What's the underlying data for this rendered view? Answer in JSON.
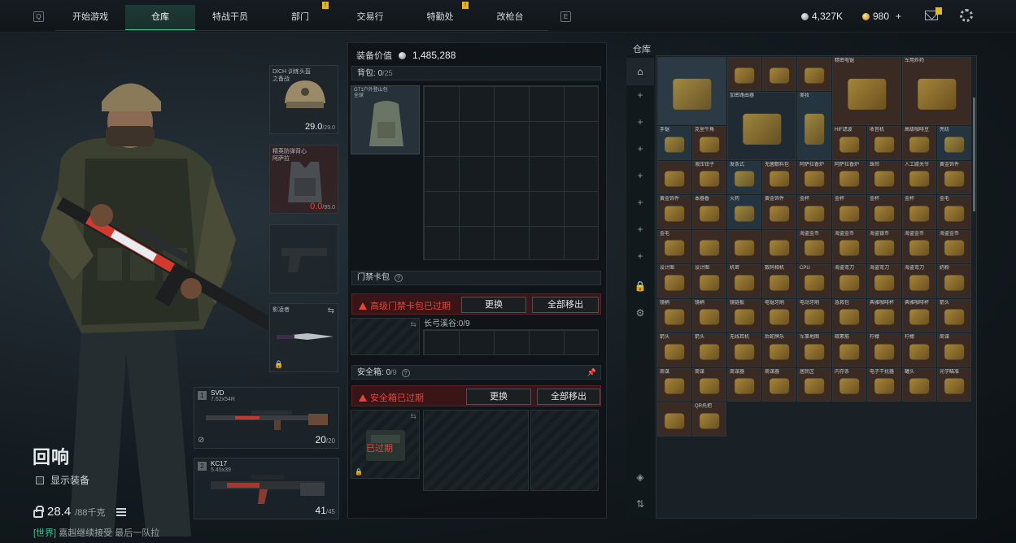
{
  "topbar": {
    "left_key": "Q",
    "right_key": "E",
    "tabs": [
      {
        "label": "开始游戏",
        "active": false,
        "badge": false
      },
      {
        "label": "仓库",
        "active": true,
        "badge": false
      },
      {
        "label": "特战干员",
        "active": false,
        "badge": false
      },
      {
        "label": "部门",
        "active": false,
        "badge": true
      },
      {
        "label": "交易行",
        "active": false,
        "badge": false
      },
      {
        "label": "特勤处",
        "active": false,
        "badge": true
      },
      {
        "label": "改枪台",
        "active": false,
        "badge": false
      }
    ],
    "silver": "4,327K",
    "gold": "980",
    "gold_plus": "+"
  },
  "operator": {
    "name": "回响",
    "show_equipment_label": "显示装备",
    "weight_value": "28.4",
    "weight_max": "/88千克",
    "chat_channel": "[世界]",
    "chat_text": "嘉赳继续接受  最后一队拉"
  },
  "gear": {
    "helmet_name": "DICH 训练头盔",
    "helmet_sub": "之备战",
    "helmet_dur": "29.0",
    "helmet_max": "/29.0",
    "armor_name": "精英防弹背心",
    "armor_sub": "阿萨拉",
    "armor_dur": "0.0",
    "armor_max": "/95.0",
    "melee_name": "影凌者"
  },
  "weapons": [
    {
      "num": "1",
      "name": "SVD",
      "caliber": "7.62x54R",
      "ammo": "20",
      "ammo_max": "/20"
    },
    {
      "num": "2",
      "name": "KC17",
      "caliber": "5.45x39",
      "ammo": "41",
      "ammo_max": "/45"
    }
  ],
  "loadout": {
    "value_label": "装备价值",
    "value": "1,485,288",
    "backpack_label": "背包:",
    "backpack_count": "0",
    "backpack_cap": "/25",
    "backpack_item": "GT1户外登山包",
    "backpack_item_sub": "全球",
    "keycard_label": "门禁卡包",
    "keycard_warning": "高级门禁卡包已过期",
    "replace_btn": "更换",
    "move_all_btn": "全部移出",
    "keycard_slot": "长弓溪谷:",
    "keycard_count": "0/9",
    "keycard_expired": "已过期",
    "safebox_label": "安全箱:",
    "safebox_count": "0",
    "safebox_cap": "/9",
    "safebox_warning": "安全箱已过期",
    "safebox_expired": "已过期"
  },
  "stash": {
    "title": "仓库",
    "cells": [
      {
        "label": "",
        "color": "#2b3a44"
      },
      {
        "label": "",
        "color": "#3a2a24"
      },
      {
        "label": "",
        "color": "#3a2a24"
      },
      {
        "label": "",
        "color": "#3a2a24"
      },
      {
        "label": "精密电锯",
        "color": "#3a2a24"
      },
      {
        "label": "军用炸药",
        "color": "#3a2a24"
      },
      {
        "label": "加密路由器",
        "color": "#1f2a33"
      },
      {
        "label": "美妆",
        "color": "#243540"
      },
      {
        "label": "手锯",
        "color": "#243540"
      },
      {
        "label": "克里牛角",
        "color": "#3a2a24"
      },
      {
        "label": "HIF滤波",
        "color": "#3a2a24"
      },
      {
        "label": "收音机",
        "color": "#3a2a24"
      },
      {
        "label": "高级咖啡豆",
        "color": "#3a2a24"
      },
      {
        "label": "亮纺",
        "color": "#243540"
      },
      {
        "label": "",
        "color": "#3a2a24"
      },
      {
        "label": "液压钳子",
        "color": "#3a2a24"
      },
      {
        "label": "发条式",
        "color": "#243540"
      },
      {
        "label": "无菌敷料包",
        "color": "#3a2a24"
      },
      {
        "label": "阿萨拉香炉",
        "color": "#3a2a24"
      },
      {
        "label": "阿萨拉香炉",
        "color": "#3a2a24"
      },
      {
        "label": "珠帘",
        "color": "#3a2a24"
      },
      {
        "label": "人工膝关节",
        "color": "#3a2a24"
      },
      {
        "label": "黄金饰件",
        "color": "#3a2a24"
      },
      {
        "label": "黄金饰件",
        "color": "#3a2a24"
      },
      {
        "label": "本器香",
        "color": "#3a2a24"
      },
      {
        "label": "火药",
        "color": "#243540"
      },
      {
        "label": "黄金饰件",
        "color": "#3a2a24"
      },
      {
        "label": "金杯",
        "color": "#3a2a24"
      },
      {
        "label": "金杯",
        "color": "#3a2a24"
      },
      {
        "label": "金杯",
        "color": "#3a2a24"
      },
      {
        "label": "金杯",
        "color": "#3a2a24"
      },
      {
        "label": "金毛",
        "color": "#3a2a24"
      },
      {
        "label": "金毛",
        "color": "#3a2a24"
      },
      {
        "label": "",
        "color": "#3a2a24"
      },
      {
        "label": "",
        "color": "#3a2a24"
      },
      {
        "label": "",
        "color": "#3a2a24"
      },
      {
        "label": "海盗金币",
        "color": "#3a2a24"
      },
      {
        "label": "海盗金币",
        "color": "#3a2a24"
      },
      {
        "label": "海盗银币",
        "color": "#3a2a24"
      },
      {
        "label": "海盗金币",
        "color": "#3a2a24"
      },
      {
        "label": "海盗金币",
        "color": "#3a2a24"
      },
      {
        "label": "设计图",
        "color": "#3a2a24"
      },
      {
        "label": "设计图",
        "color": "#3a2a24"
      },
      {
        "label": "机密",
        "color": "#3a2a24"
      },
      {
        "label": "数码相机",
        "color": "#3a2a24"
      },
      {
        "label": "CPU",
        "color": "#3a2a24"
      },
      {
        "label": "海盗弯刀",
        "color": "#3a2a24"
      },
      {
        "label": "海盗弯刀",
        "color": "#3a2a24"
      },
      {
        "label": "海盗弯刀",
        "color": "#3a2a24"
      },
      {
        "label": "奶粉",
        "color": "#3a2a24"
      },
      {
        "label": "镜柄",
        "color": "#3a2a24"
      },
      {
        "label": "镜柄",
        "color": "#3a2a24"
      },
      {
        "label": "镜链板",
        "color": "#3a2a24"
      },
      {
        "label": "电锯牙刷",
        "color": "#3a2a24"
      },
      {
        "label": "电动牙刷",
        "color": "#3a2a24"
      },
      {
        "label": "急救包",
        "color": "#3a2a24"
      },
      {
        "label": "典雅咖啡杯",
        "color": "#3a2a24"
      },
      {
        "label": "典雅咖啡杯",
        "color": "#3a2a24"
      },
      {
        "label": "箭头",
        "color": "#3a2a24"
      },
      {
        "label": "箭头",
        "color": "#3a2a24"
      },
      {
        "label": "箭头",
        "color": "#3a2a24"
      },
      {
        "label": "无线耳机",
        "color": "#3a2a24"
      },
      {
        "label": "后蛇牌乐",
        "color": "#3a2a24"
      },
      {
        "label": "军事地图",
        "color": "#3a2a24"
      },
      {
        "label": "碳素筋",
        "color": "#3a2a24"
      },
      {
        "label": "柠檬",
        "color": "#3a2a24"
      },
      {
        "label": "柠檬",
        "color": "#3a2a24"
      },
      {
        "label": "周谋",
        "color": "#3a2a24"
      },
      {
        "label": "周谋",
        "color": "#3a2a24"
      },
      {
        "label": "周谋",
        "color": "#3a2a24"
      },
      {
        "label": "周谋器",
        "color": "#3a2a24"
      },
      {
        "label": "周谋器",
        "color": "#3a2a24"
      },
      {
        "label": "居民区",
        "color": "#3a2a24"
      },
      {
        "label": "内存条",
        "color": "#3a2a24"
      },
      {
        "label": "电子干扰器",
        "color": "#3a2a24"
      },
      {
        "label": "罐头",
        "color": "#3a2a24"
      },
      {
        "label": "光学瞄准",
        "color": "#3a2a24"
      },
      {
        "label": "",
        "color": "#3a2a24"
      },
      {
        "label": "QR托把",
        "color": "#3a2a24"
      }
    ]
  }
}
